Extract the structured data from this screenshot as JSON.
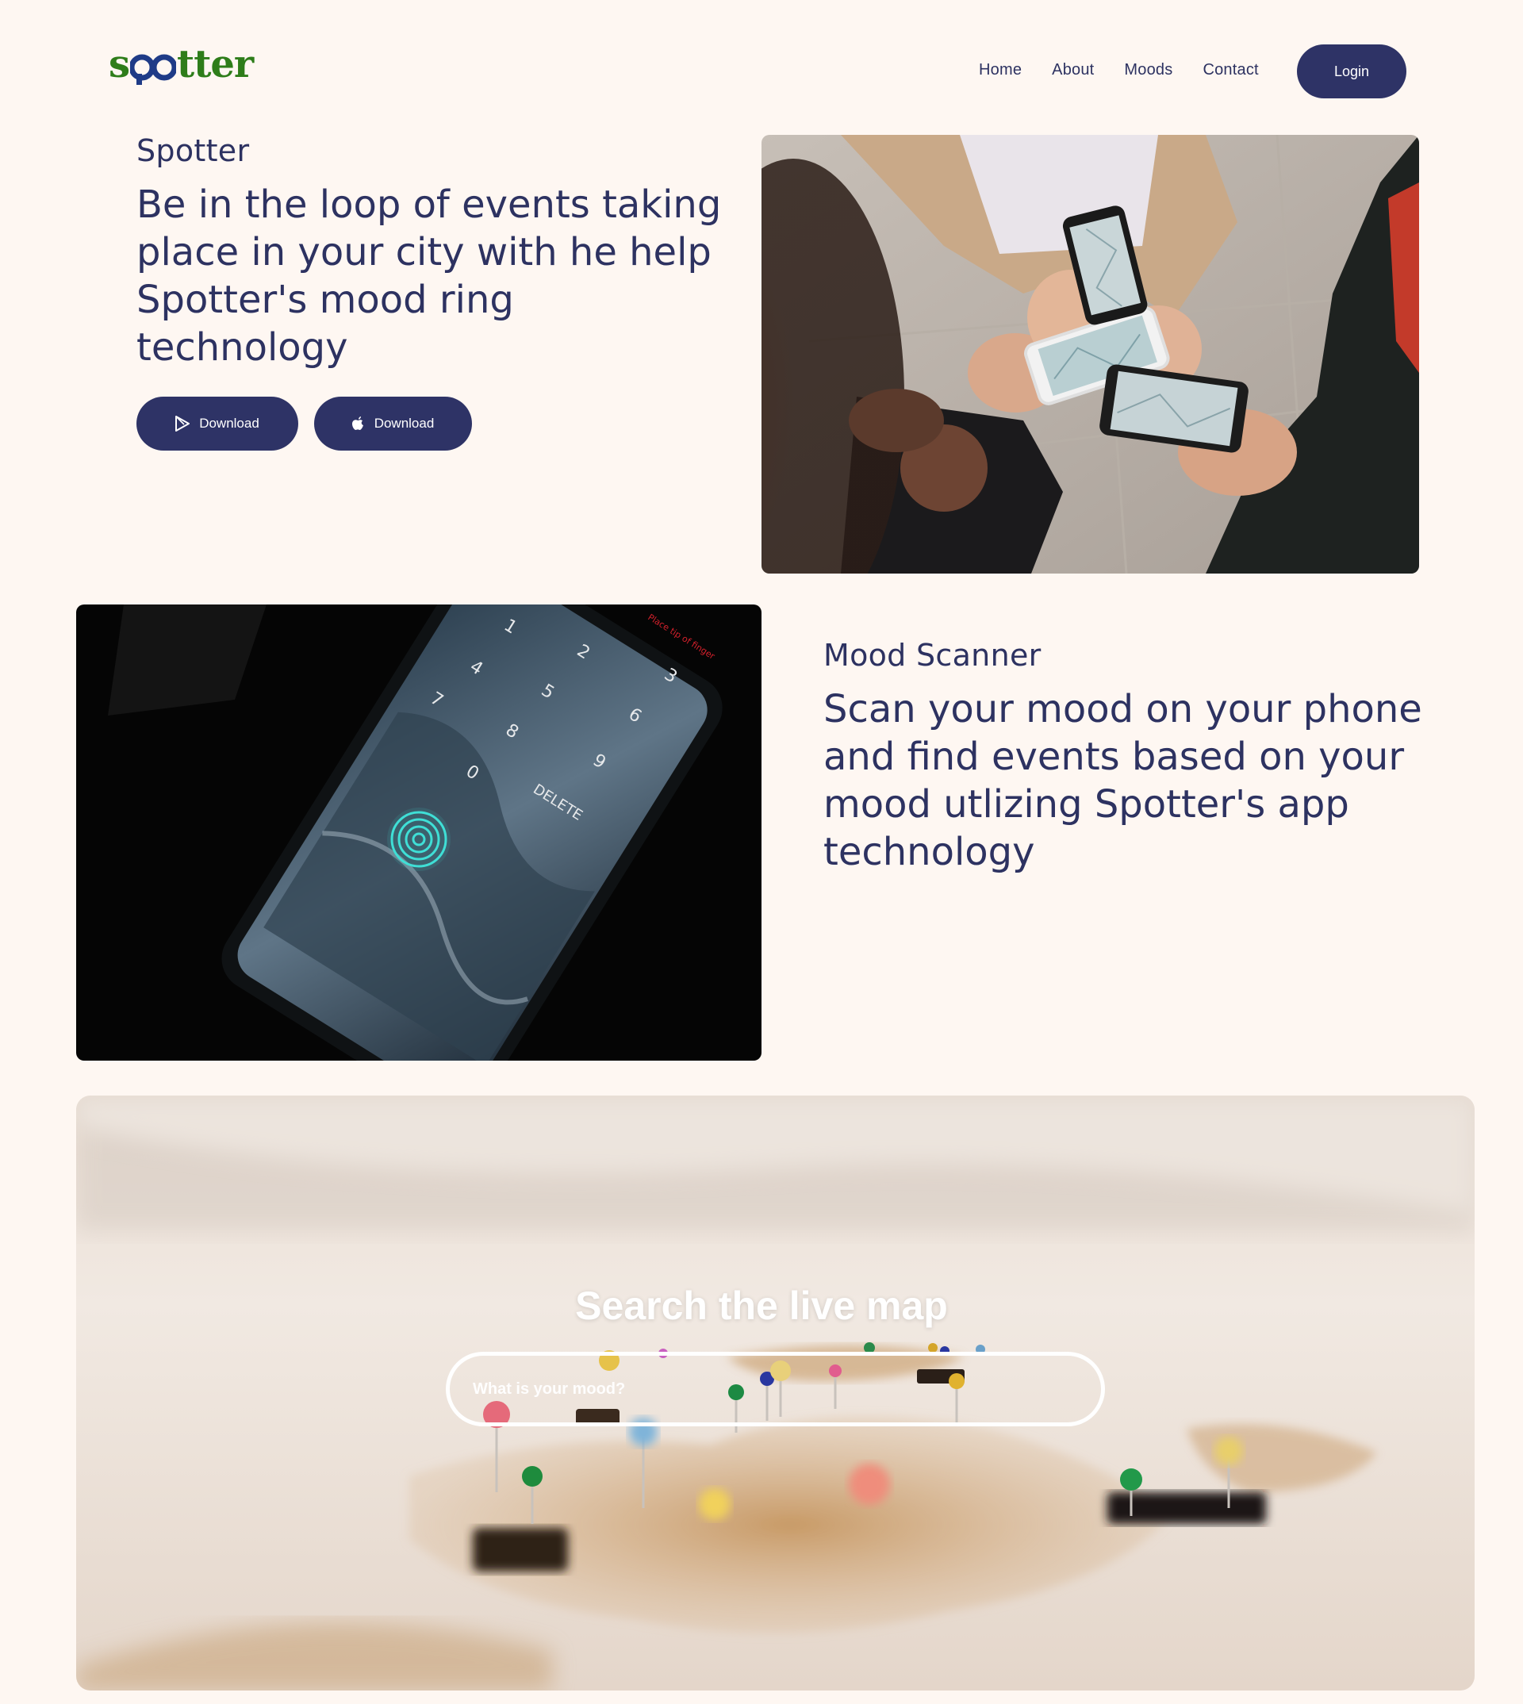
{
  "brand": {
    "logo_text": "spotter",
    "green": "#2e7d1a",
    "blue": "#1f3b87"
  },
  "nav": {
    "items": [
      "Home",
      "About",
      "Moods",
      "Contact"
    ],
    "login_label": "Login"
  },
  "hero": {
    "eyebrow": "Spotter",
    "headline_lines": [
      "Be in the loop of events taking",
      "place in your city with he help",
      "Spotter's mood ring",
      "technology"
    ],
    "buttons": [
      {
        "label": "Download",
        "icon": "play-store-icon"
      },
      {
        "label": "Download",
        "icon": "apple-icon"
      }
    ]
  },
  "scanner": {
    "eyebrow": "Mood Scanner",
    "headline_lines": [
      "Scan your mood on your phone",
      "and find events based on your",
      "mood utlizing Spotter's app",
      "technology"
    ]
  },
  "map": {
    "title": "Search the live map",
    "search_placeholder": "What is your mood?"
  },
  "colors": {
    "accent": "#2e3366",
    "background": "#fef7f2",
    "text": "#2d3261"
  }
}
